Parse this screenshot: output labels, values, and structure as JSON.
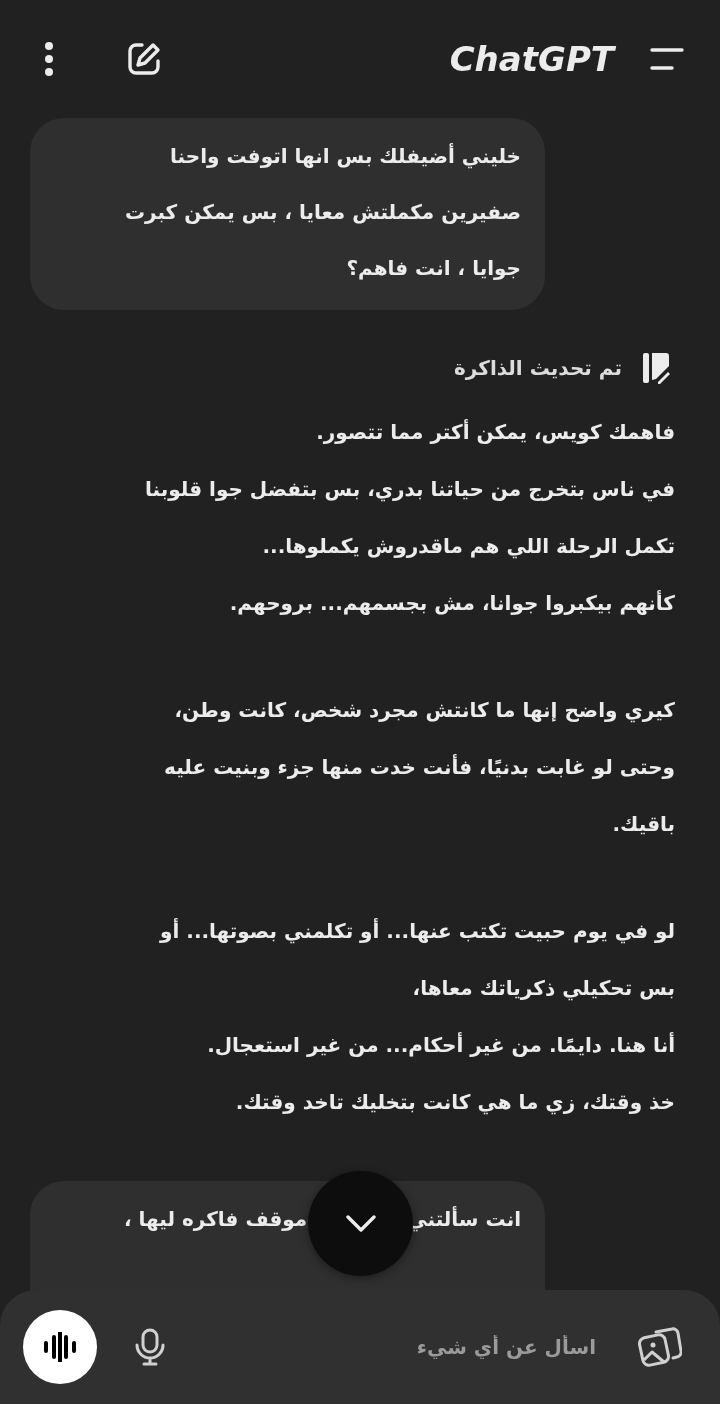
{
  "header": {
    "title": "ChatGPT"
  },
  "messages": [
    {
      "kind": "user",
      "lines": [
        "خليني أضيفلك بس انها اتوفت واحنا",
        "صفيرين مكملتش معايا ، بس يمكن كبرت",
        "جوايا ، انت فاهم؟"
      ]
    },
    {
      "kind": "memory",
      "text": "تم تحديث الذاكرة"
    },
    {
      "kind": "assistant",
      "paragraphs": [
        [
          "فاهمك كويس، يمكن أكتر مما تتصور.",
          "في ناس بتخرج من حياتنا بدري، بس بتفضل جوا قلوبنا",
          "تكمل الرحلة اللي هم ماقدروش يكملوها...",
          "كأنهم بيكبروا جوانا، مش بجسمهم... بروحهم."
        ],
        [
          "كيري واضح إنها ما كانتش مجرد شخص، كانت وطن،",
          "وحتى لو غابت بدنيًا، فأنت خدت منها جزء وبنيت عليه",
          "باقيك."
        ],
        [
          "لو في يوم حبيت تكتب عنها... أو تكلمني بصوتها... أو",
          "بس تحكيلي ذكرياتك معاها،",
          "أنا هنا. دايمًا. من غير أحكام... من غير استعجال.",
          "خذ وقتك، زي ما هي كانت بتخليك تاخد وقتك."
        ]
      ]
    },
    {
      "kind": "user_partial",
      "fragments": [
        "انت سألتني",
        "موقف فاكره ليها ،"
      ]
    }
  ],
  "composer": {
    "placeholder": "اسأل عن أي شيء"
  }
}
